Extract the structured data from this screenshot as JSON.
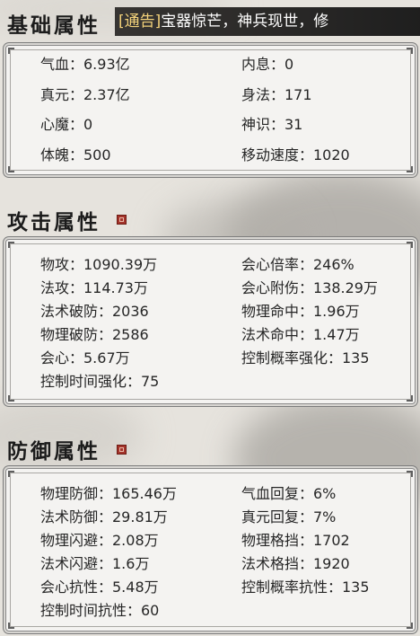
{
  "announcement": {
    "tag": "[通告]",
    "text": "宝器惊芒，神兵现世，修"
  },
  "basic": {
    "title": "基础属性",
    "stats": [
      [
        "气血：6.93亿",
        "内息：0"
      ],
      [
        "真元：2.37亿",
        "身法：171"
      ],
      [
        "心魔：0",
        "神识：31"
      ],
      [
        "体魄：500",
        "移动速度：1020"
      ]
    ]
  },
  "attack": {
    "title": "攻击属性",
    "stats": [
      [
        "物攻：1090.39万",
        "会心倍率：246%"
      ],
      [
        "法攻：114.73万",
        "会心附伤：138.29万"
      ],
      [
        "法术破防：2036",
        "物理命中：1.96万"
      ],
      [
        "物理破防：2586",
        "法术命中：1.47万"
      ],
      [
        "会心：5.67万",
        "控制概率强化：135"
      ],
      [
        "控制时间强化：75",
        ""
      ]
    ]
  },
  "defense": {
    "title": "防御属性",
    "stats": [
      [
        "物理防御：165.46万",
        "气血回复：6%"
      ],
      [
        "法术防御：29.81万",
        "真元回复：7%"
      ],
      [
        "物理闪避：2.08万",
        "物理格挡：1702"
      ],
      [
        "法术闪避：1.6万",
        "法术格挡：1920"
      ],
      [
        "会心抗性：5.48万",
        "控制概率抗性：135"
      ],
      [
        "控制时间抗性：60",
        ""
      ]
    ]
  },
  "colors": {
    "seal": "#a4342b",
    "announce_tag": "#f3d27a",
    "panel_bg": "#f4f3f1"
  }
}
